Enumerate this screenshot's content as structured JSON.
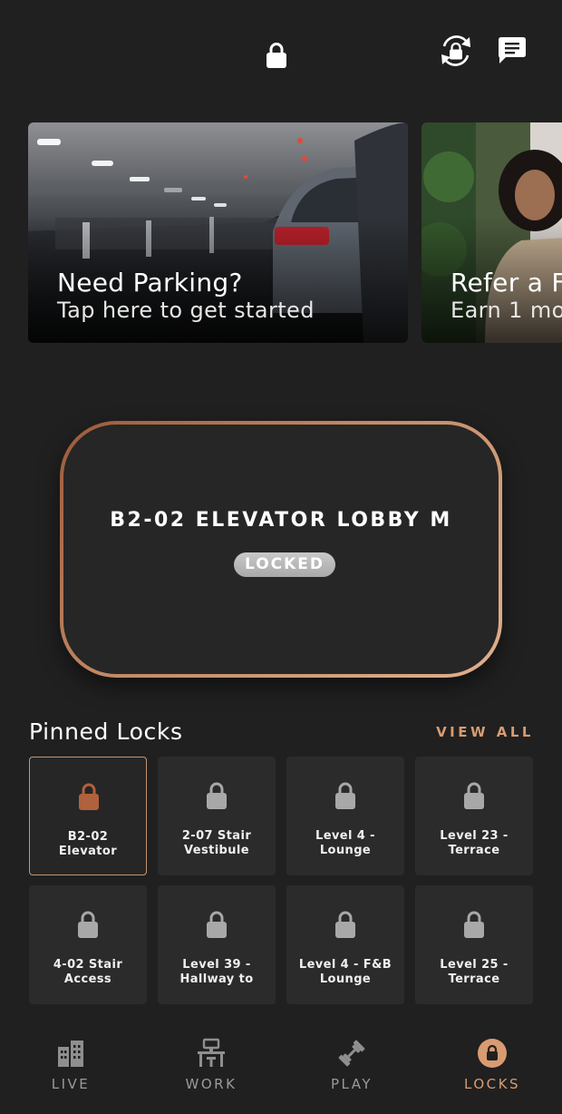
{
  "carousel": {
    "cards": [
      {
        "title": "Need Parking?",
        "subtitle": "Tap here to get started"
      },
      {
        "title": "Refer a F",
        "subtitle": "Earn 1 mo"
      }
    ]
  },
  "current_lock": {
    "name": "B2-02 ELEVATOR LOBBY M",
    "status": "LOCKED"
  },
  "pinned": {
    "title": "Pinned Locks",
    "view_all": "VIEW ALL",
    "locks": [
      {
        "label": "B2-02\nElevator",
        "active": true
      },
      {
        "label": "2-07 Stair\nVestibule",
        "active": false
      },
      {
        "label": "Level 4  -\nLounge",
        "active": false
      },
      {
        "label": "Level 23 -\nTerrace",
        "active": false
      },
      {
        "label": "4-02 Stair\nAccess",
        "active": false
      },
      {
        "label": "Level 39 -\nHallway to",
        "active": false
      },
      {
        "label": "Level 4 - F&B\nLounge",
        "active": false
      },
      {
        "label": "Level 25 -\nTerrace",
        "active": false
      }
    ]
  },
  "nav": {
    "items": [
      {
        "label": "LIVE",
        "icon": "building-icon"
      },
      {
        "label": "WORK",
        "icon": "desk-icon"
      },
      {
        "label": "PLAY",
        "icon": "dumbbell-icon"
      },
      {
        "label": "LOCKS",
        "icon": "lock-icon"
      }
    ],
    "active_index": 3
  },
  "colors": {
    "background": "#202020",
    "accent": "#d89b72",
    "active_lock_icon": "#b0613e",
    "inactive_lock_icon": "#a8a8a8",
    "tile": "#2b2b2b"
  }
}
